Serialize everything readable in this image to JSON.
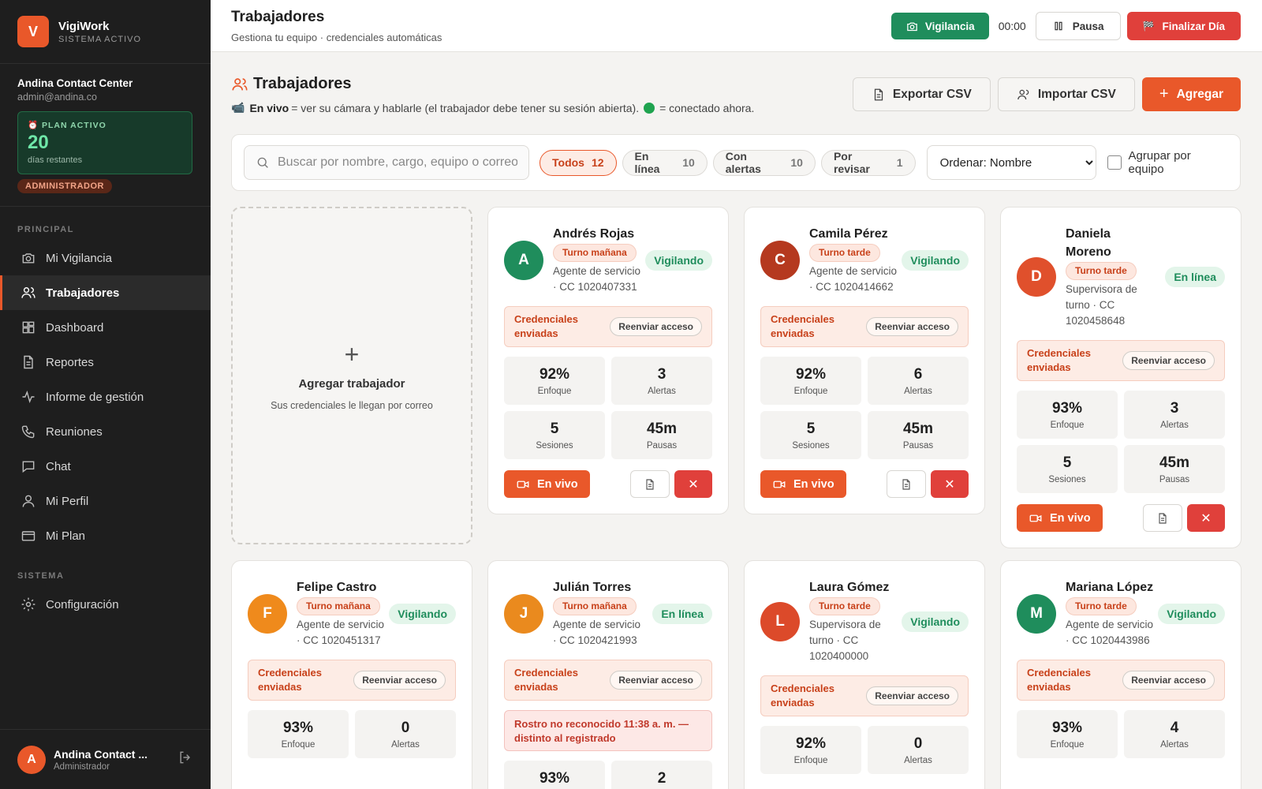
{
  "brand": {
    "name": "VigiWork",
    "status": "SISTEMA ACTIVO",
    "logo_letter": "V"
  },
  "org": {
    "name": "Andina Contact Center",
    "email": "admin@andina.co"
  },
  "plan": {
    "label": "PLAN ACTIVO",
    "days": "20",
    "remaining": "días restantes",
    "role": "ADMINISTRADOR"
  },
  "nav": {
    "section_main": "PRINCIPAL",
    "section_system": "SISTEMA",
    "items": [
      {
        "label": "Mi Vigilancia",
        "icon": "camera-icon"
      },
      {
        "label": "Trabajadores",
        "icon": "users-icon"
      },
      {
        "label": "Dashboard",
        "icon": "dashboard-icon"
      },
      {
        "label": "Reportes",
        "icon": "document-icon"
      },
      {
        "label": "Informe de gestión",
        "icon": "activity-icon"
      },
      {
        "label": "Reuniones",
        "icon": "phone-icon"
      },
      {
        "label": "Chat",
        "icon": "chat-icon"
      },
      {
        "label": "Mi Perfil",
        "icon": "user-icon"
      },
      {
        "label": "Mi Plan",
        "icon": "credit-card-icon"
      }
    ],
    "system_items": [
      {
        "label": "Configuración",
        "icon": "gear-icon"
      }
    ]
  },
  "user": {
    "initial": "A",
    "name": "Andina Contact ...",
    "role": "Administrador"
  },
  "topbar": {
    "title": "Trabajadores",
    "subtitle": "Gestiona tu equipo · credenciales automáticas",
    "vigilance": "Vigilancia",
    "timer": "00:00",
    "pause": "Pausa",
    "end_day": "Finalizar Día"
  },
  "page": {
    "title": "Trabajadores",
    "note_live": "En vivo",
    "note_rest": "= ver su cámara y hablarle (el trabajador debe tener su sesión abierta).",
    "note_dot": "= conectado ahora.",
    "export": "Exportar CSV",
    "import": "Importar CSV",
    "add": "Agregar"
  },
  "filters": {
    "search_placeholder": "Buscar por nombre, cargo, equipo o correo",
    "chips": [
      {
        "label": "Todos",
        "count": "12"
      },
      {
        "label": "En línea",
        "count": "10"
      },
      {
        "label": "Con alertas",
        "count": "10"
      },
      {
        "label": "Por revisar",
        "count": "1"
      }
    ],
    "sort_selected": "Ordenar: Nombre",
    "group_label": "Agrupar por equipo"
  },
  "add_card": {
    "plus": "+",
    "title": "Agregar trabajador",
    "subtitle": "Sus credenciales le llegan por correo"
  },
  "labels": {
    "cred": "Credenciales enviadas",
    "resend": "Reenviar acceso",
    "focus": "Enfoque",
    "alerts": "Alertas",
    "sessions": "Sesiones",
    "pauses": "Pausas",
    "live": "En vivo"
  },
  "workers": [
    {
      "initial": "A",
      "name": "Andrés Rojas",
      "shift": "Turno mañana",
      "role": "Agente de servicio · CC 1020407331",
      "status": "Vigilando",
      "color": "#1f8d5c",
      "focus": "92%",
      "alerts": "3",
      "sessions": "5",
      "pauses": "45m"
    },
    {
      "initial": "C",
      "name": "Camila Pérez",
      "shift": "Turno tarde",
      "role": "Agente de servicio · CC 1020414662",
      "status": "Vigilando",
      "color": "#b5391f",
      "focus": "92%",
      "alerts": "6",
      "sessions": "5",
      "pauses": "45m"
    },
    {
      "initial": "D",
      "name": "Daniela Moreno",
      "shift": "Turno tarde",
      "role": "Supervisora de turno · CC 1020458648",
      "status": "En línea",
      "color": "#e0502c",
      "focus": "93%",
      "alerts": "3",
      "sessions": "5",
      "pauses": "45m"
    },
    {
      "initial": "F",
      "name": "Felipe Castro",
      "shift": "Turno mañana",
      "role": "Agente de servicio · CC 1020451317",
      "status": "Vigilando",
      "color": "#ef8a1c",
      "focus": "93%",
      "alerts": "0"
    },
    {
      "initial": "J",
      "name": "Julián Torres",
      "shift": "Turno mañana",
      "role": "Agente de servicio · CC 1020421993",
      "status": "En línea",
      "color": "#ea8a1e",
      "alert_msg": "Rostro no reconocido 11:38 a. m. — distinto al registrado",
      "focus": "93%",
      "alerts": "2"
    },
    {
      "initial": "L",
      "name": "Laura Gómez",
      "shift": "Turno tarde",
      "role": "Supervisora de turno · CC 1020400000",
      "status": "Vigilando",
      "color": "#dc4a2a",
      "focus": "92%",
      "alerts": "0"
    },
    {
      "initial": "M",
      "name": "Mariana López",
      "shift": "Turno tarde",
      "role": "Agente de servicio · CC 1020443986",
      "status": "Vigilando",
      "color": "#1f8d5c",
      "focus": "93%",
      "alerts": "4"
    }
  ]
}
